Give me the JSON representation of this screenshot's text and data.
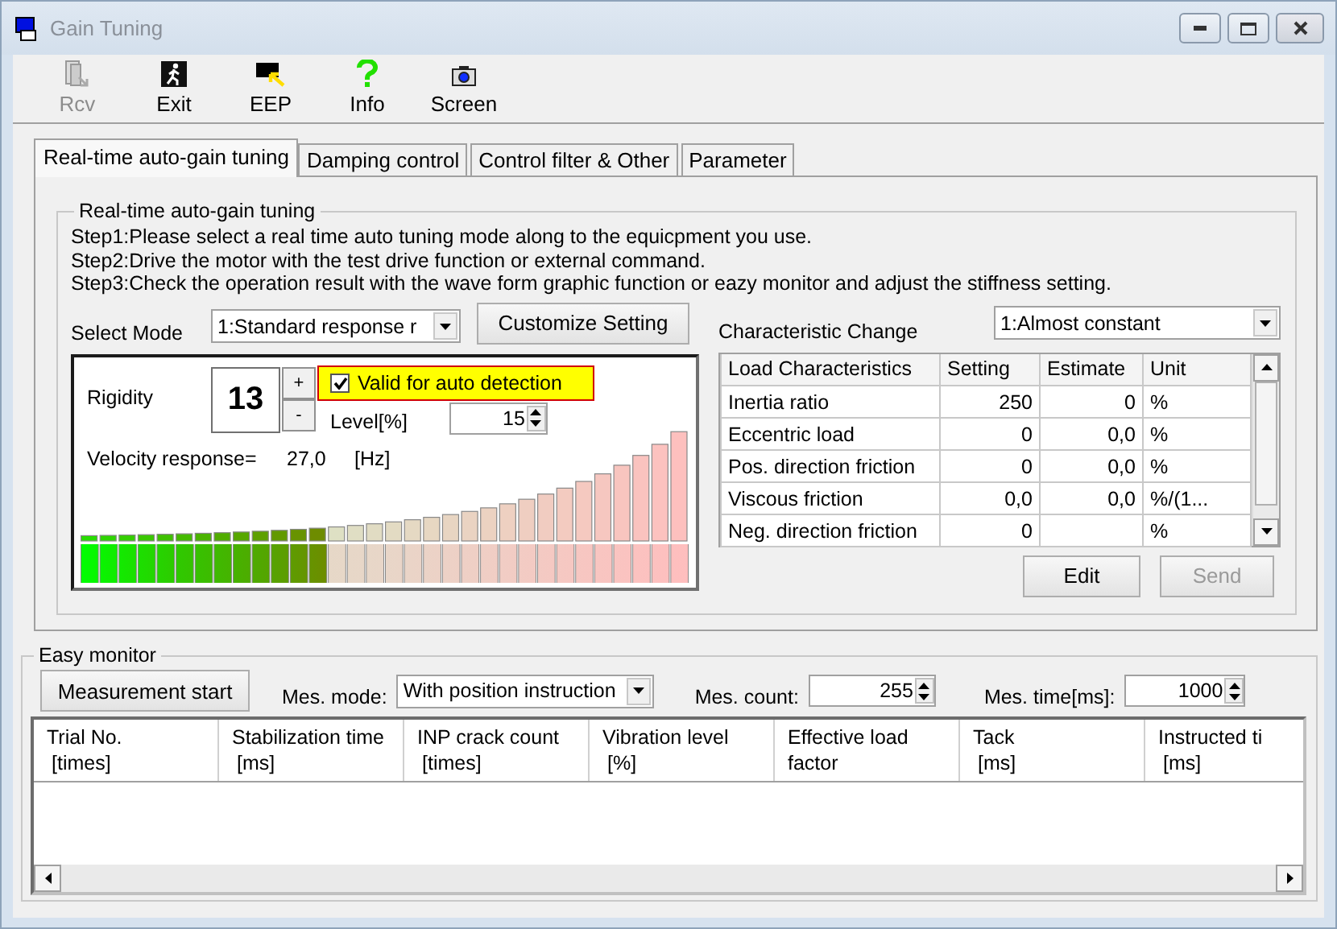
{
  "window": {
    "title": "Gain Tuning"
  },
  "toolbar": [
    {
      "kind": "rcv",
      "label": "Rcv",
      "disabled": true
    },
    {
      "kind": "exit",
      "label": "Exit",
      "disabled": false
    },
    {
      "kind": "eep",
      "label": "EEP",
      "disabled": false
    },
    {
      "kind": "info",
      "label": "Info",
      "disabled": false
    },
    {
      "kind": "screen",
      "label": "Screen",
      "disabled": false
    }
  ],
  "tabs": [
    {
      "label": "Real-time auto-gain tuning",
      "selected": true
    },
    {
      "label": "Damping control",
      "selected": false
    },
    {
      "label": "Control filter & Other",
      "selected": false
    },
    {
      "label": "Parameter",
      "selected": false
    }
  ],
  "tuning": {
    "title": "Real-time auto-gain tuning",
    "steps": [
      "Step1:Please select a real time auto tuning mode along to the equicpment you use.",
      "Step2:Drive the motor with the test drive function or external command.",
      "Step3:Check the operation result with the wave form graphic function or eazy monitor and adjust the stiffness setting."
    ],
    "select_mode_label": "Select Mode",
    "select_mode_value": "1:Standard response r",
    "customize_button": "Customize Setting",
    "rigidity_label": "Rigidity",
    "rigidity_value": "13",
    "plus": "+",
    "minus": "-",
    "auto_detection": {
      "label": "Valid for auto detection",
      "checked": true
    },
    "level_label": "Level[%]",
    "level_value": "15",
    "velocity_label": "Velocity response=",
    "velocity_value": "27,0",
    "velocity_unit": "[Hz]",
    "rigidity_meter": {
      "level": 0.40625
    },
    "characteristic_label": "Characteristic Change",
    "characteristic_value": "1:Almost constant",
    "table": {
      "columns": [
        "Load Characteristics",
        "Setting",
        "Estimate",
        "Unit"
      ],
      "rows": [
        [
          "Inertia ratio",
          "250",
          "0",
          "%"
        ],
        [
          "Eccentric load",
          "0",
          "0,0",
          "%"
        ],
        [
          "Pos. direction friction",
          "0",
          "0,0",
          "%"
        ],
        [
          "Viscous friction",
          "0,0",
          "0,0",
          "%/(1..."
        ],
        [
          "Neg. direction friction",
          "0",
          "",
          "%"
        ]
      ]
    },
    "edit_button": {
      "label": "Edit",
      "disabled": false
    },
    "send_button": {
      "label": "Send",
      "disabled": true
    }
  },
  "monitor": {
    "title": "Easy monitor",
    "start_button": "Measurement start",
    "mode_label": "Mes. mode:",
    "mode_value": "With position instruction",
    "count_label": "Mes. count:",
    "count_value": "255",
    "time_label": "Mes. time[ms]:",
    "time_value": "1000",
    "columns": [
      [
        "Trial No.",
        "[times]"
      ],
      [
        "Stabilization time",
        "[ms]"
      ],
      [
        "INP crack count",
        "[times]"
      ],
      [
        "Vibration level",
        "[%]"
      ],
      [
        "Effective load",
        "factor"
      ],
      [
        "Tack",
        "[ms]"
      ],
      [
        "Instructed ti",
        "[ms]"
      ]
    ]
  }
}
